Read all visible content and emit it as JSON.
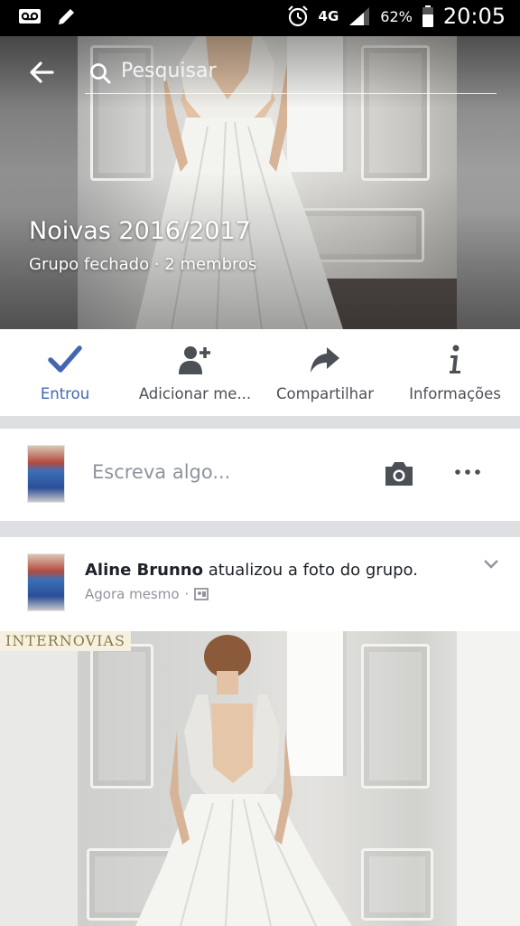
{
  "status_bar": {
    "network": "4G",
    "battery_percent": "62%",
    "time": "20:05"
  },
  "header": {
    "search_placeholder": "Pesquisar"
  },
  "group": {
    "title": "Noivas 2016/2017",
    "subtitle": "Grupo fechado · 2 membros"
  },
  "actions": [
    {
      "label": "Entrou",
      "icon": "checkmark-icon",
      "active": true,
      "color": "#4267b2"
    },
    {
      "label": "Adicionar me...",
      "icon": "add-person-icon"
    },
    {
      "label": "Compartilhar",
      "icon": "share-arrow-icon"
    },
    {
      "label": "Informações",
      "icon": "info-icon"
    }
  ],
  "composer": {
    "placeholder": "Escreva algo..."
  },
  "post": {
    "author": "Aline Brunno",
    "action_text": "atualizou a foto do grupo.",
    "time": "Agora mesmo",
    "photo_brand": "INTERNOVIAS"
  },
  "colors": {
    "accent": "#4267b2",
    "text_secondary": "#90949c",
    "separator": "#dddfe2"
  }
}
